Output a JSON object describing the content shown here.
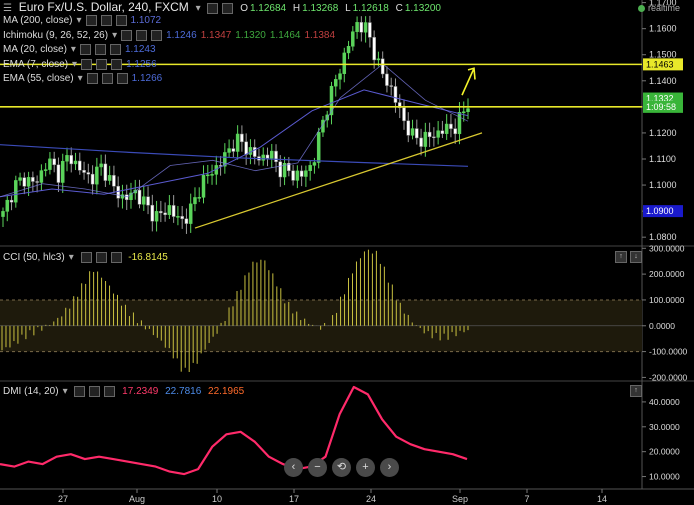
{
  "header": {
    "symbol": "Euro Fx/U.S. Dollar, 240, FXCM",
    "ohlc_labels": [
      "O",
      "H",
      "L",
      "C"
    ],
    "ohlc_values": [
      "1.12684",
      "1.13268",
      "1.12618",
      "1.13200"
    ],
    "brand": "realtime"
  },
  "indicators": [
    {
      "label": "MA (200, close)",
      "values": [
        "1.1072"
      ],
      "colors": [
        "#5b6bd6"
      ]
    },
    {
      "label": "Ichimoku (9, 26, 52, 26)",
      "values": [
        "1.1246",
        "1.1347",
        "1.1320",
        "1.1464",
        "1.1384"
      ],
      "colors": [
        "#4d6bd8",
        "#c04040",
        "#3ea83e",
        "#3ea83e",
        "#c04040"
      ]
    },
    {
      "label": "MA (20, close)",
      "values": [
        "1.1243"
      ],
      "colors": [
        "#4d6bd8"
      ]
    },
    {
      "label": "EMA (7, close)",
      "values": [
        "1.1256"
      ],
      "colors": [
        "#4d6bd8"
      ]
    },
    {
      "label": "EMA (55, close)",
      "values": [
        "1.1266"
      ],
      "colors": [
        "#4d6bd8"
      ]
    }
  ],
  "cci": {
    "label": "CCI (50, hlc3)",
    "value": "-16.8145",
    "value_color": "#e8e84a"
  },
  "dmi": {
    "label": "DMI (14, 20)",
    "values": [
      "17.2349",
      "22.7816",
      "22.1965"
    ],
    "colors": [
      "#ff3a6a",
      "#4d8be8",
      "#ff6a2a"
    ]
  },
  "nav": {
    "items": [
      "‹",
      "−",
      "⟲",
      "+",
      "›"
    ]
  },
  "chart_data": [
    {
      "type": "candlestick",
      "title": "Euro Fx/U.S. Dollar, 240, FXCM",
      "x_tick_labels": [
        "27",
        "Aug",
        "10",
        "17",
        "24",
        "Sep",
        "7",
        "14"
      ],
      "ylim": [
        1.077,
        1.171
      ],
      "y_ticks": [
        1.08,
        1.09,
        1.1,
        1.11,
        1.12,
        1.13,
        1.14,
        1.15,
        1.16,
        1.17
      ],
      "y_tick_labels": [
        "1.0800",
        "1.0900",
        "1.1000",
        "1.1100",
        "1.1200",
        "1.1300",
        "1.1400",
        "1.1500",
        "1.1600",
        "1.1700"
      ],
      "price_labels": [
        {
          "value": 1.1463,
          "label": "1.1463",
          "style": "yellow"
        },
        {
          "value": 1.1332,
          "label": "1.1332",
          "style": "green"
        },
        {
          "value": 1.13,
          "label": "1:09:58",
          "style": "green"
        },
        {
          "value": 1.09,
          "label": "1.0900",
          "style": "blue"
        }
      ],
      "horizontal_lines": [
        1.1463,
        1.13
      ],
      "trendline": [
        [
          1.0835,
          1.12
        ]
      ],
      "close_path": [
        1.0885,
        1.0995,
        1.1025,
        1.1005,
        1.1095,
        1.1045,
        1.1115,
        1.1055,
        1.1025,
        1.1075,
        1.0985,
        1.0945,
        1.0975,
        1.0915,
        1.0875,
        1.0915,
        1.0855,
        1.0905,
        1.1015,
        1.1055,
        1.1105,
        1.1175,
        1.1145,
        1.1095,
        1.1125,
        1.1065,
        1.1045,
        1.1035,
        1.1085,
        1.1265,
        1.1395,
        1.1515,
        1.1625,
        1.1585,
        1.1445,
        1.1375,
        1.1265,
        1.1185,
        1.1175,
        1.1195,
        1.1215,
        1.1225,
        1.132
      ],
      "ma200_path": [
        1.1155,
        1.1128,
        1.1105,
        1.1088,
        1.1072
      ],
      "ma20_path": [
        1.0955,
        1.1005,
        1.0985,
        1.0955,
        1.1075,
        1.1095,
        1.1055,
        1.1085,
        1.1335,
        1.1465,
        1.1325,
        1.1245
      ],
      "ema55_path": [
        1.0955,
        1.0985,
        1.0965,
        1.1005,
        1.1045,
        1.1145,
        1.1285,
        1.1365,
        1.1315,
        1.1266
      ]
    },
    {
      "type": "histogram",
      "name": "CCI (50, hlc3)",
      "ylim": [
        -210,
        305
      ],
      "y_ticks": [
        -200,
        -100,
        0,
        100,
        200,
        300
      ],
      "y_tick_labels": [
        "-200.0000",
        "-100.0000",
        "0.0000",
        "100.0000",
        "200.0000",
        "300.0000"
      ],
      "bands": [
        100,
        -100
      ],
      "values": [
        -95,
        -70,
        -40,
        -20,
        0,
        30,
        80,
        150,
        220,
        180,
        120,
        60,
        20,
        -20,
        -60,
        -110,
        -180,
        -150,
        -80,
        -20,
        60,
        150,
        240,
        260,
        180,
        90,
        40,
        10,
        -10,
        20,
        120,
        230,
        295,
        280,
        180,
        80,
        20,
        -20,
        -40,
        -45,
        -30,
        -17
      ]
    },
    {
      "type": "line",
      "name": "DMI (14, 20)",
      "ylim": [
        5,
        48
      ],
      "y_ticks": [
        10,
        20,
        30,
        40
      ],
      "y_tick_labels": [
        "10.0000",
        "20.0000",
        "30.0000",
        "40.0000"
      ],
      "values": [
        15,
        14,
        16,
        15,
        18,
        19,
        17,
        18,
        17,
        16,
        15,
        14,
        12,
        11,
        13,
        22,
        27,
        28,
        24,
        18,
        15,
        13,
        14,
        18,
        35,
        46,
        43,
        33,
        26,
        23,
        21,
        20,
        19,
        17
      ]
    }
  ]
}
